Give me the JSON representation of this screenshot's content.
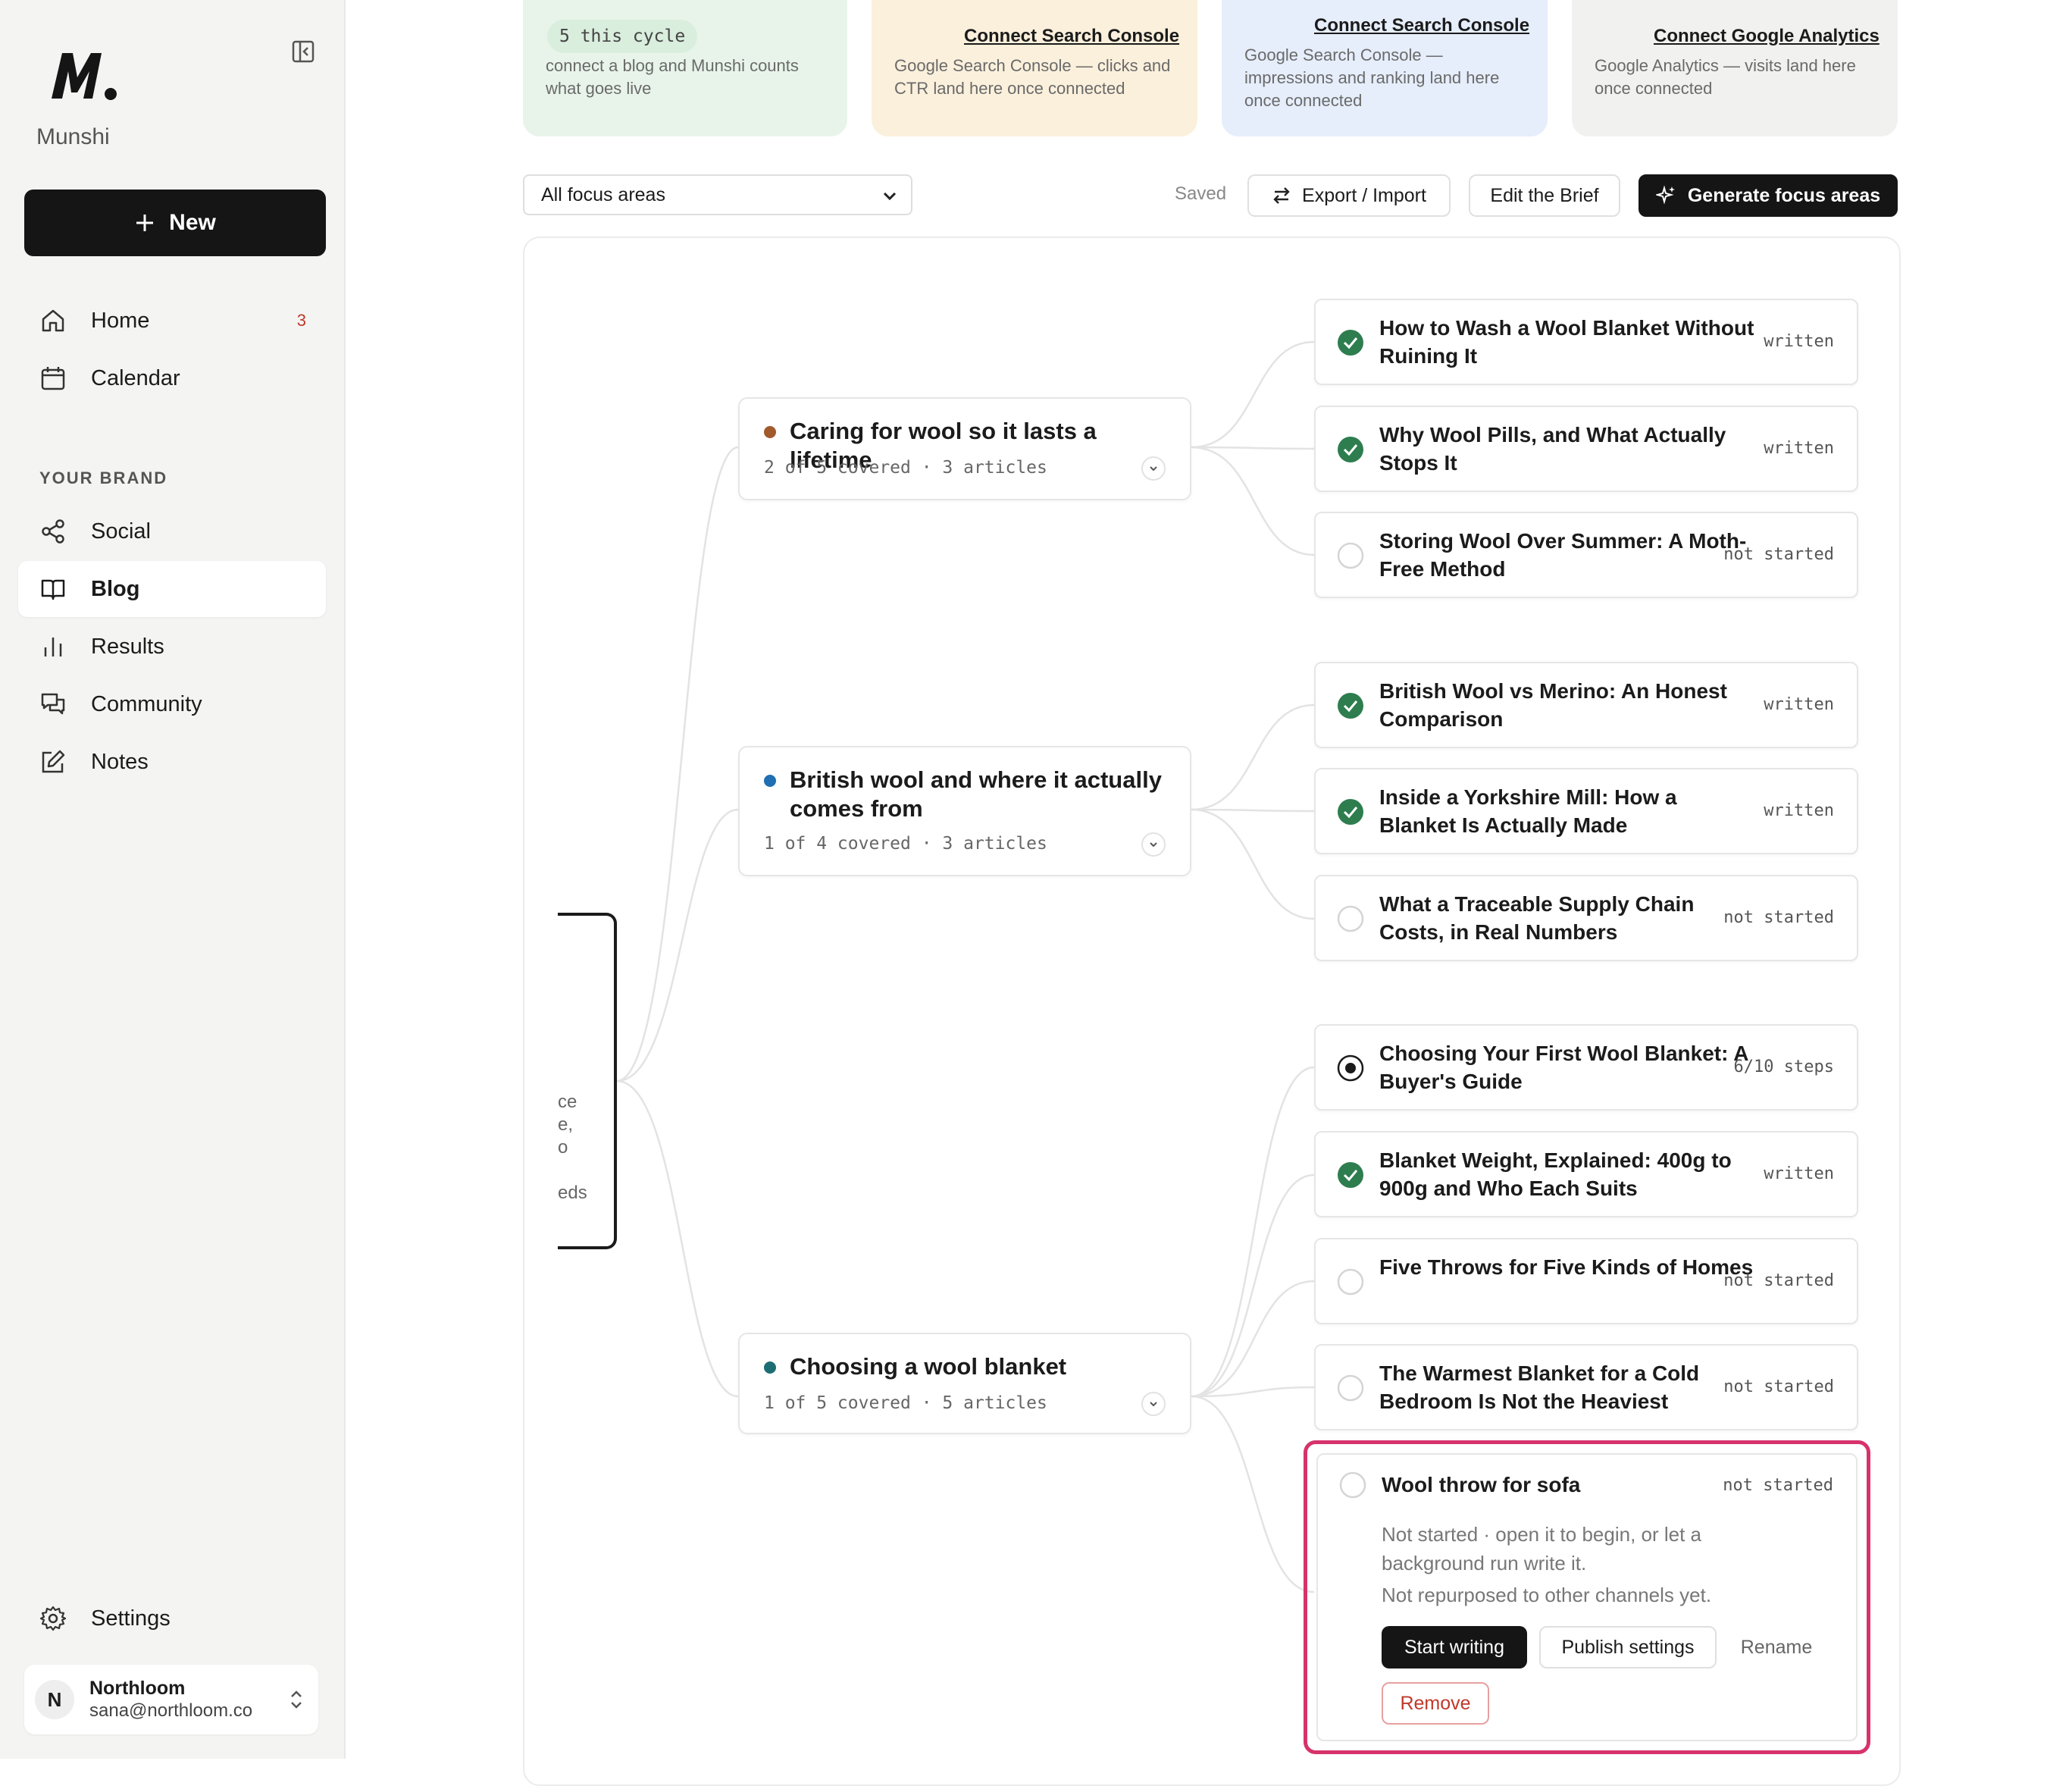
{
  "sidebar": {
    "brand": "Munshi",
    "new_label": "New",
    "nav": [
      {
        "label": "Home",
        "icon": "home-icon",
        "badge": "3"
      },
      {
        "label": "Calendar",
        "icon": "calendar-icon"
      }
    ],
    "section_label": "YOUR BRAND",
    "brand_nav": [
      {
        "label": "Social",
        "icon": "share-icon"
      },
      {
        "label": "Blog",
        "icon": "book-icon",
        "active": true
      },
      {
        "label": "Results",
        "icon": "bar-chart-icon"
      },
      {
        "label": "Community",
        "icon": "chat-icon"
      },
      {
        "label": "Notes",
        "icon": "edit-icon"
      }
    ],
    "settings_label": "Settings",
    "account": {
      "initial": "N",
      "name": "Northloom",
      "email": "sana@northloom.co"
    }
  },
  "cards": [
    {
      "pill": "5 this cycle",
      "text": "connect a blog and Munshi counts what goes live",
      "color": "#e8f4ea"
    },
    {
      "link": "Connect Search Console",
      "text": "Google Search Console — clicks and CTR land here once connected",
      "color": "#fbf0dc"
    },
    {
      "link": "Connect Search Console",
      "text": "Google Search Console — impressions and ranking land here once connected",
      "color": "#e6eefb"
    },
    {
      "link": "Connect Google Analytics",
      "text": "Google Analytics — visits land here once connected",
      "color": "#f1f1f0"
    }
  ],
  "toolbar": {
    "filter_value": "All focus areas",
    "saved": "Saved",
    "export_label": "Export / Import",
    "brief_label": "Edit the Brief",
    "generate_label": "Generate focus areas"
  },
  "root_stub_lines": [
    "ce",
    "e,",
    "o",
    "eds"
  ],
  "focus_areas": [
    {
      "title": "Caring for wool so it lasts a lifetime",
      "meta": "2 of 5 covered · 3 articles",
      "dot": "#a05a2c"
    },
    {
      "title": "British wool and where it actually comes from",
      "meta": "1 of 4 covered · 3 articles",
      "dot": "#1f6fb2"
    },
    {
      "title": "Choosing a wool blanket",
      "meta": "1 of 5 covered · 5 articles",
      "dot": "#1d6e74"
    }
  ],
  "articles": [
    {
      "title": "How to Wash a Wool Blanket Without Ruining It",
      "status": "written",
      "state": "done"
    },
    {
      "title": "Why Wool Pills, and What Actually Stops It",
      "status": "written",
      "state": "done"
    },
    {
      "title": "Storing Wool Over Summer: A Moth-Free Method",
      "status": "not started",
      "state": "empty"
    },
    {
      "title": "British Wool vs Merino: An Honest Comparison",
      "status": "written",
      "state": "done"
    },
    {
      "title": "Inside a Yorkshire Mill: How a Blanket Is Actually Made",
      "status": "written",
      "state": "done"
    },
    {
      "title": "What a Traceable Supply Chain Costs, in Real Numbers",
      "status": "not started",
      "state": "empty"
    },
    {
      "title": "Choosing Your First Wool Blanket: A Buyer's Guide",
      "status": "6/10 steps",
      "state": "progress"
    },
    {
      "title": "Blanket Weight, Explained: 400g to 900g and Who Each Suits",
      "status": "written",
      "state": "done"
    },
    {
      "title": "Five Throws for Five Kinds of Homes",
      "status": "not started",
      "state": "empty"
    },
    {
      "title": "The Warmest Blanket for a Cold Bedroom Is Not the Heaviest",
      "status": "not started",
      "state": "empty"
    }
  ],
  "expanded": {
    "title": "Wool throw for sofa",
    "status": "not started",
    "desc": "Not started · open it to begin, or let a background run write it.",
    "desc2": "Not repurposed to other channels yet.",
    "start": "Start writing",
    "publish": "Publish settings",
    "rename": "Rename",
    "remove": "Remove"
  },
  "colors": {
    "check_green": "#2e7d4f",
    "highlight": "#d6336c"
  }
}
